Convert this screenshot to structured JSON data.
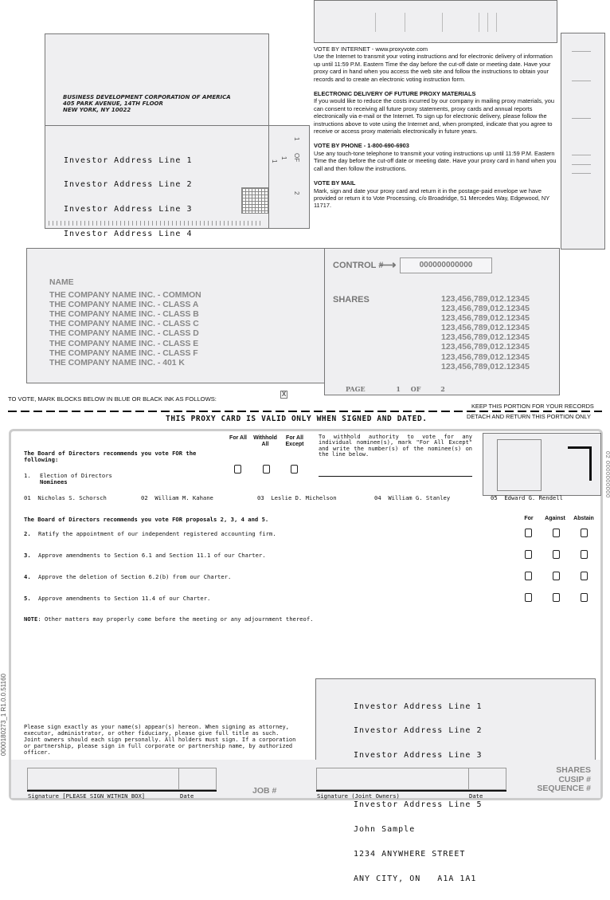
{
  "envelope": {
    "return_address": [
      "BUSINESS DEVELOPMENT CORPORATION OF AMERICA",
      "405 PARK AVENUE, 14TH FLOOR",
      "NEW YORK, NY 10022"
    ],
    "mailing_address": [
      "Investor Address Line 1",
      "Investor Address Line 2",
      "Investor Address Line 3",
      "Investor Address Line 4",
      "Investor Address Line 5",
      "John Sample",
      "1234 ANYWHERE STREET",
      "ANY CITY, ON   A1A 1A1"
    ],
    "side_page": {
      "a": "1",
      "b": "1",
      "page": "1",
      "of": "OF",
      "total": "2"
    }
  },
  "instructions": [
    {
      "title": "VOTE BY INTERNET - www.proxyvote.com",
      "body": "Use the Internet to transmit your voting instructions and for electronic delivery of information up until 11:59 P.M. Eastern Time the day before the cut-off date or meeting date. Have your proxy card in hand when you access the web site and follow the instructions to obtain your records and to create an electronic voting instruction form."
    },
    {
      "title": "ELECTRONIC DELIVERY OF FUTURE PROXY MATERIALS",
      "body": "If you would like to reduce the costs incurred by our company in mailing proxy materials, you can consent to receiving all future proxy statements, proxy cards and annual reports electronically via e-mail or the Internet. To sign up for electronic delivery, please follow the instructions above to vote using the Internet and, when prompted, indicate that you agree to receive or access proxy materials electronically in future years."
    },
    {
      "title": "VOTE BY PHONE - 1-800-690-6903",
      "body": "Use any touch-tone telephone to transmit your voting instructions up until 11:59 P.M. Eastern Time the day before the cut-off date or meeting date. Have your proxy card in hand when you call and then follow the instructions."
    },
    {
      "title": "VOTE BY MAIL",
      "body": "Mark, sign and date your proxy card and return it in the postage-paid envelope we have provided or return it to Vote Processing, c/o Broadridge, 51 Mercedes Way, Edgewood, NY 11717."
    }
  ],
  "holdings": {
    "name_label": "NAME",
    "names": [
      "THE COMPANY NAME INC. - COMMON",
      "THE COMPANY NAME INC. - CLASS A",
      "THE COMPANY NAME INC. - CLASS B",
      "THE COMPANY NAME INC. - CLASS C",
      "THE COMPANY NAME INC. - CLASS D",
      "THE COMPANY NAME INC. - CLASS E",
      "THE COMPANY NAME INC. - CLASS F",
      "THE COMPANY NAME INC. - 401 K"
    ],
    "control_label": "CONTROL #",
    "control_arrow": "⟶",
    "control_number": "000000000000",
    "shares_label": "SHARES",
    "shares": [
      "123,456,789,012.12345",
      "123,456,789,012.12345",
      "123,456,789,012.12345",
      "123,456,789,012.12345",
      "123,456,789,012.12345",
      "123,456,789,012.12345",
      "123,456,789,012.12345",
      "123,456,789,012.12345"
    ],
    "page_label": "PAGE",
    "page": "1",
    "of_label": "OF",
    "page_total": "2"
  },
  "divider": {
    "vote_instruction": "TO VOTE, MARK BLOCKS BELOW IN BLUE OR BLACK INK AS FOLLOWS:",
    "x_mark": "X",
    "keep": "KEEP THIS PORTION FOR YOUR RECORDS",
    "valid": "THIS PROXY CARD IS VALID ONLY WHEN SIGNED AND DATED.",
    "detach": "DETACH AND RETURN THIS PORTION ONLY"
  },
  "ballot": {
    "directors_intro": "The Board of Directors recommends you vote FOR the following:",
    "item1_num": "1.",
    "item1_title": "Election of Directors",
    "nominees_label": "Nominees",
    "col_for_all": "For All",
    "col_withhold_all": "Withhold All",
    "col_for_all_except": "For All Except",
    "except_instruction": "To withhold authority to vote for any individual nominee(s), mark \"For All Except\" and write the number(s) of the nominee(s) on the line below.",
    "nominees": [
      {
        "num": "01",
        "name": "Nicholas S. Schorsch"
      },
      {
        "num": "02",
        "name": "William M. Kahane"
      },
      {
        "num": "03",
        "name": "Leslie D. Michelson"
      },
      {
        "num": "04",
        "name": "William G. Stanley"
      },
      {
        "num": "05",
        "name": "Edward G. Rendell"
      }
    ],
    "proposals_intro": "The Board of Directors recommends you vote FOR proposals 2, 3, 4 and 5.",
    "col_for": "For",
    "col_against": "Against",
    "col_abstain": "Abstain",
    "proposals": [
      {
        "num": "2.",
        "text": "Ratify the appointment of our independent registered accounting firm."
      },
      {
        "num": "3.",
        "text": "Approve amendments to Section 6.1 and Section 11.1 of our Charter."
      },
      {
        "num": "4.",
        "text": "Approve the deletion of Section 6.2(b) from our Charter."
      },
      {
        "num": "5.",
        "text": "Approve amendments to Section 11.4 of our Charter."
      }
    ],
    "note_label": "NOTE",
    "note": ": Other matters may properly come before the meeting or any adjournment thereof.",
    "side_code": "02   0000000000",
    "sign_instruction": "Please sign exactly as your name(s) appear(s) hereon. When signing as attorney, executor, administrator, or other fiduciary, please give full title as such. Joint owners should each sign personally. All holders must sign. If a corporation or partnership, please sign in full corporate or partnership name, by authorized officer.",
    "signature_label": "Signature [PLEASE SIGN WITHIN BOX]",
    "date_label": "Date",
    "job_label": "JOB #",
    "joint_signature_label": "Signature (Joint Owners)",
    "joint_date_label": "Date",
    "shares_label": "SHARES",
    "cusip_label": "CUSIP #",
    "sequence_label": "SEQUENCE #",
    "joint_address": [
      "Investor Address Line 1",
      "Investor Address Line 2",
      "Investor Address Line 3",
      "Investor Address Line 4",
      "Investor Address Line 5",
      "John Sample",
      "1234 ANYWHERE STREET",
      "ANY CITY, ON   A1A 1A1"
    ]
  },
  "left_code": "0000180273_1   R1.0.0.51160"
}
